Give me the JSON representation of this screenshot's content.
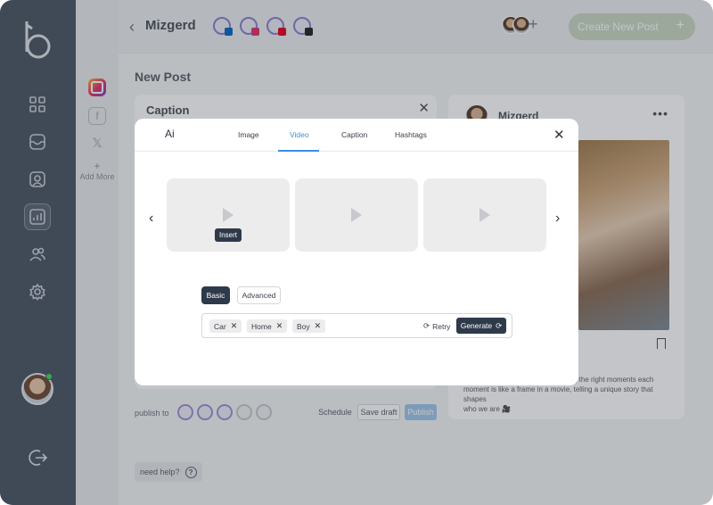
{
  "header": {
    "back_icon": "chevron-left-icon",
    "brand": "Mizgerd",
    "create_button": "Create New Post",
    "accounts": [
      "linkedin",
      "instagram",
      "pinterest",
      "threads"
    ]
  },
  "sidebar": {
    "items": [
      "dashboard-icon",
      "inbox-icon",
      "profile-icon",
      "analytics-icon",
      "team-icon",
      "settings-icon"
    ],
    "active_item": "analytics-icon",
    "logout_icon": "logout-icon"
  },
  "platforms": {
    "items": [
      "instagram-icon",
      "facebook-icon",
      "x-icon"
    ],
    "add_more_symbol": "+",
    "add_more": "Add More"
  },
  "page": {
    "title": "New Post"
  },
  "caption_card": {
    "title": "Caption"
  },
  "preview": {
    "name": "Mizgerd",
    "text": "capturing the right moments each moment is like a frame in a movie, telling a unique story that shapes who we are 🎥",
    "visible_text_fragment": "pturing the right moments each",
    "line2": "moment is like a frame in a movie, telling a unique story that shapes",
    "line3": "who we are 🎥"
  },
  "publish": {
    "label": "publish to",
    "schedule": "Schedule",
    "save_draft": "Save draft",
    "publish": "Publish"
  },
  "help": {
    "label": "need help?",
    "icon_text": "?"
  },
  "modal": {
    "title": "Ai",
    "tabs": [
      "Image",
      "Video",
      "Caption",
      "Hashtags"
    ],
    "active_tab": "Video",
    "close_symbol": "✕",
    "prev_symbol": "‹",
    "next_symbol": "›",
    "insert_label": "Insert",
    "modes": [
      "Basic",
      "Advanced"
    ],
    "active_mode": "Basic",
    "keywords": [
      "Car",
      "Home",
      "Boy"
    ],
    "chip_remove_symbol": "✕",
    "retry_label": "Retry",
    "generate_label": "Generate"
  },
  "colors": {
    "sidebar": "#4a5563",
    "accent": "#3c8ee3",
    "dark_button": "#2e3a4a",
    "create_button": "#c9d7c2"
  }
}
